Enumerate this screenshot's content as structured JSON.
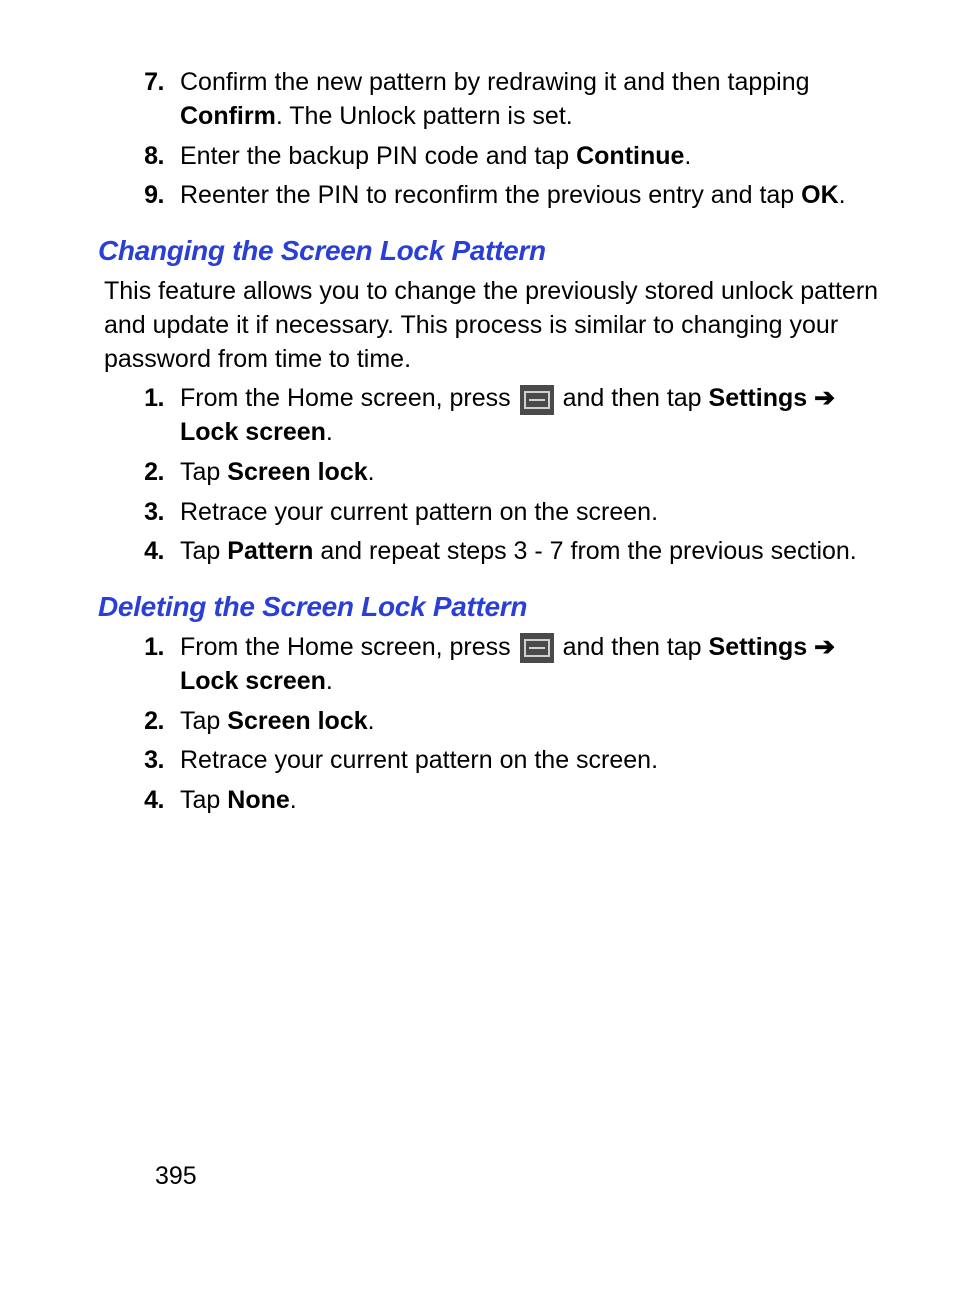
{
  "topSteps": [
    {
      "num": "7.",
      "segments": [
        {
          "t": "Confirm the new pattern by redrawing it and then tapping "
        },
        {
          "t": "Confirm",
          "bold": true
        },
        {
          "t": ". The Unlock pattern is set."
        }
      ]
    },
    {
      "num": "8.",
      "segments": [
        {
          "t": "Enter the backup PIN code and tap "
        },
        {
          "t": "Continue",
          "bold": true
        },
        {
          "t": "."
        }
      ]
    },
    {
      "num": "9.",
      "segments": [
        {
          "t": "Reenter the PIN to reconfirm the previous entry and tap "
        },
        {
          "t": "OK",
          "bold": true
        },
        {
          "t": "."
        }
      ]
    }
  ],
  "section1": {
    "heading": "Changing the Screen Lock Pattern",
    "intro": "This feature allows you to change the previously stored unlock pattern and update it if necessary. This process is similar to changing your password from time to time.",
    "steps": [
      {
        "num": "1.",
        "segments": [
          {
            "t": "From the Home screen, press "
          },
          {
            "icon": "menu"
          },
          {
            "t": " and then tap "
          },
          {
            "t": "Settings",
            "bold": true
          },
          {
            "t": " "
          },
          {
            "t": "➔",
            "bold": true,
            "arrow": true
          },
          {
            "t": " "
          },
          {
            "t": "Lock screen",
            "bold": true
          },
          {
            "t": "."
          }
        ]
      },
      {
        "num": "2.",
        "segments": [
          {
            "t": "Tap "
          },
          {
            "t": "Screen lock",
            "bold": true
          },
          {
            "t": "."
          }
        ]
      },
      {
        "num": "3.",
        "segments": [
          {
            "t": "Retrace your current pattern on the screen."
          }
        ]
      },
      {
        "num": "4.",
        "segments": [
          {
            "t": "Tap "
          },
          {
            "t": "Pattern",
            "bold": true
          },
          {
            "t": " and repeat steps 3 - 7 from the previous section."
          }
        ]
      }
    ]
  },
  "section2": {
    "heading": "Deleting the Screen Lock Pattern",
    "steps": [
      {
        "num": "1.",
        "segments": [
          {
            "t": "From the Home screen, press "
          },
          {
            "icon": "menu"
          },
          {
            "t": " and then tap "
          },
          {
            "t": "Settings",
            "bold": true
          },
          {
            "t": " "
          },
          {
            "t": "➔",
            "bold": true,
            "arrow": true
          },
          {
            "t": " "
          },
          {
            "t": "Lock screen",
            "bold": true
          },
          {
            "t": "."
          }
        ]
      },
      {
        "num": "2.",
        "segments": [
          {
            "t": "Tap "
          },
          {
            "t": "Screen lock",
            "bold": true
          },
          {
            "t": "."
          }
        ]
      },
      {
        "num": "3.",
        "segments": [
          {
            "t": "Retrace your current pattern on the screen."
          }
        ]
      },
      {
        "num": "4.",
        "segments": [
          {
            "t": "Tap "
          },
          {
            "t": "None",
            "bold": true
          },
          {
            "t": "."
          }
        ]
      }
    ]
  },
  "pageNumber": "395"
}
